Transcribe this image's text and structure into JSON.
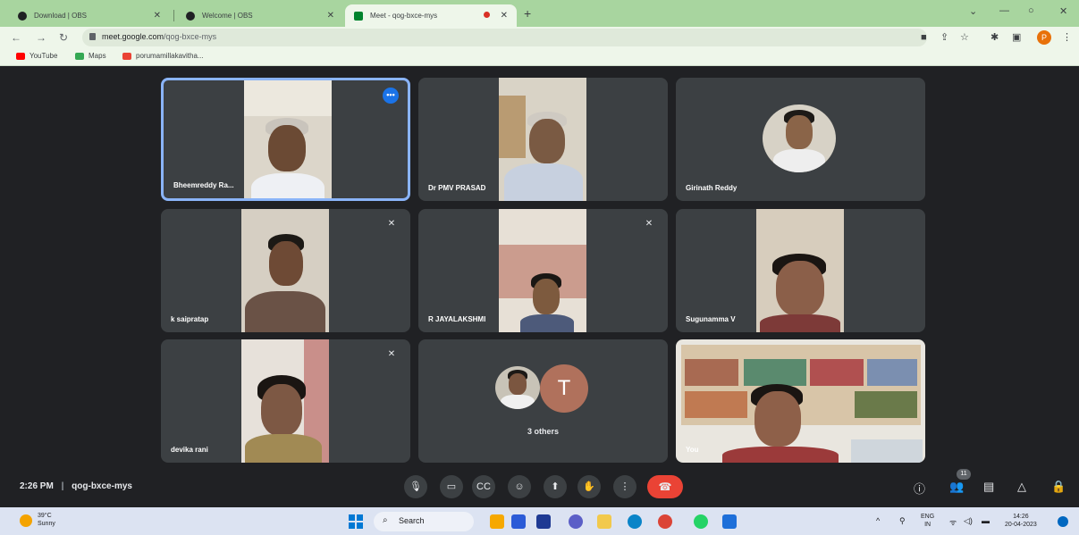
{
  "browser": {
    "tabs": [
      {
        "label": "Download | OBS"
      },
      {
        "label": "Welcome | OBS"
      },
      {
        "label": "Meet - qog-bxce-mys"
      }
    ],
    "url_host": "meet.google.com",
    "url_path": "/qog-bxce-mys",
    "profile_initial": "P",
    "bookmarks": [
      "YouTube",
      "Maps",
      "porumamillakavitha..."
    ]
  },
  "participants": [
    {
      "name": "Bheemreddy Ra...",
      "muted": false,
      "speaking": true
    },
    {
      "name": "Dr PMV PRASAD",
      "muted": false,
      "speaking": false
    },
    {
      "name": "Girinath Reddy",
      "muted": false,
      "speaking": false
    },
    {
      "name": "k saipratap",
      "muted": true,
      "speaking": false
    },
    {
      "name": "R JAYALAKSHMI",
      "muted": true,
      "speaking": false
    },
    {
      "name": "Sugunamma V",
      "muted": false,
      "speaking": false
    },
    {
      "name": "devika rani",
      "muted": true,
      "speaking": false
    },
    {
      "name": "3 others",
      "initial": "T"
    },
    {
      "name": "You",
      "muted": false,
      "speaking": false
    }
  ],
  "meeting": {
    "time": "2:26 PM",
    "code": "qog-bxce-mys",
    "participant_count": "11"
  },
  "icons": {
    "mic": "mic-icon",
    "camera": "camera-icon",
    "captions": "captions-icon",
    "reactions": "emoji-icon",
    "present": "present-icon",
    "raise_hand": "hand-icon",
    "more": "more-vert-icon",
    "end_call": "end-call-icon",
    "info": "info-icon",
    "people": "people-icon",
    "chat": "chat-icon",
    "activities": "activities-icon",
    "host_controls": "lock-icon"
  },
  "taskbar": {
    "temperature": "39°C",
    "condition": "Sunny",
    "search_label": "Search",
    "lang_top": "ENG",
    "lang_bottom": "IN",
    "time": "14:26",
    "date": "20-04-2023"
  },
  "colors": {
    "tabbar": "#a8d59f",
    "meet_bg": "#202124",
    "tile_bg": "#3c4043",
    "active_border": "#8ab4f8",
    "end_call": "#ea4335"
  }
}
